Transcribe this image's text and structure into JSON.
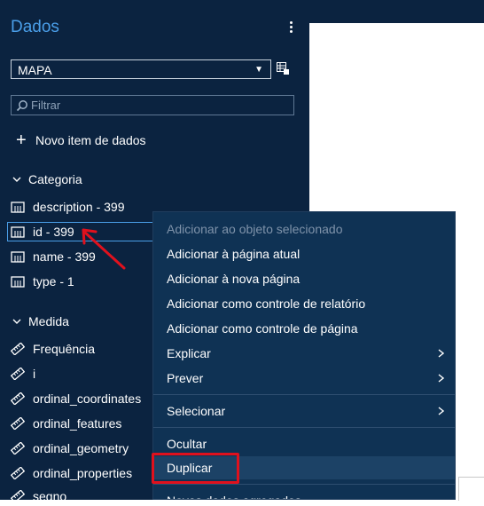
{
  "panel": {
    "title": "Dados",
    "source_select": "MAPA",
    "filter_placeholder": "Filtrar",
    "new_item_label": "Novo item de dados",
    "categoria": {
      "label": "Categoria",
      "items": [
        "description - 399",
        "id - 399",
        "name - 399",
        "type - 1"
      ]
    },
    "medida": {
      "label": "Medida",
      "items": [
        "Frequência",
        "i",
        "ordinal_coordinates",
        "ordinal_features",
        "ordinal_geometry",
        "ordinal_properties",
        "segno"
      ]
    }
  },
  "context_menu": {
    "items": [
      "Adicionar ao objeto selecionado",
      "Adicionar à página atual",
      "Adicionar à nova página",
      "Adicionar como controle de relatório",
      "Adicionar como controle de página",
      "Explicar",
      "Prever",
      "Selecionar",
      "Ocultar",
      "Duplicar",
      "Novos dados agregados"
    ]
  },
  "colors": {
    "panel_bg": "#0b2340",
    "menu_bg": "#0f3254",
    "accent": "#4a9ee8",
    "annotation": "#e0111d"
  }
}
